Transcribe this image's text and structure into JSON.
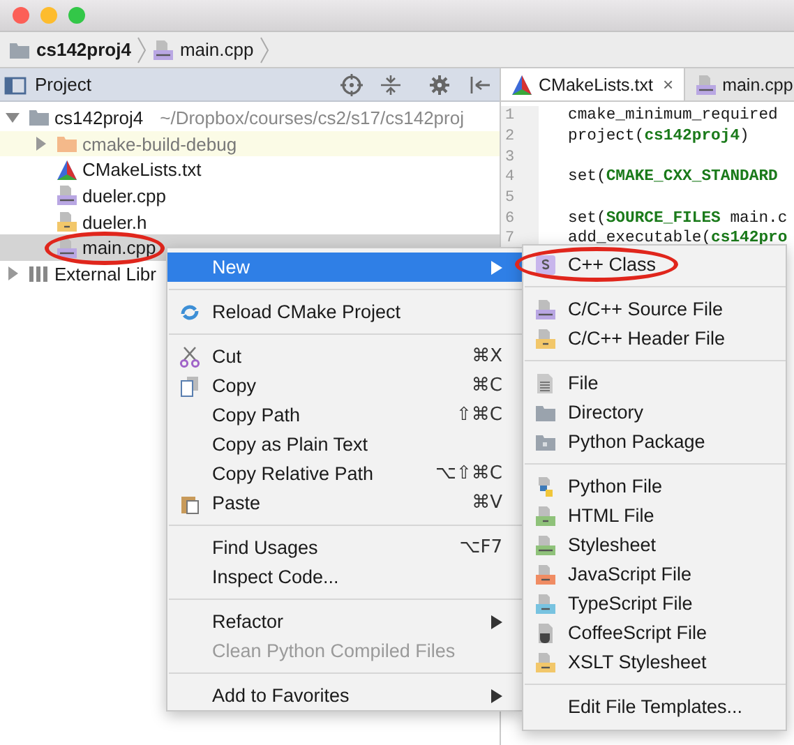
{
  "window": {
    "traffic_lights": [
      {
        "color": "#fc5f57"
      },
      {
        "color": "#fdbc2e"
      },
      {
        "color": "#33c748"
      }
    ]
  },
  "breadcrumbs": [
    {
      "label": "cs142proj4",
      "kind": "folder"
    },
    {
      "label": "main.cpp",
      "kind": "cpp"
    }
  ],
  "project_panel": {
    "title": "Project"
  },
  "tree": [
    {
      "label": "cs142proj4",
      "path": "~/Dropbox/courses/cs2/s17/cs142proj",
      "kind": "module",
      "expanded": true,
      "selected": false,
      "circled": false,
      "children": [
        {
          "label": "cmake-build-debug",
          "kind": "excluded-folder",
          "expanded": false,
          "selected": false,
          "circled": false
        },
        {
          "label": "CMakeLists.txt",
          "kind": "cmake",
          "selected": false,
          "circled": false
        },
        {
          "label": "dueler.cpp",
          "kind": "cpp",
          "selected": false,
          "circled": false
        },
        {
          "label": "dueler.h",
          "kind": "header",
          "selected": false,
          "circled": false
        },
        {
          "label": "main.cpp",
          "kind": "cpp",
          "selected": true,
          "circled": true
        }
      ]
    },
    {
      "label": "External Libr",
      "kind": "libraries",
      "expanded": false,
      "selected": false,
      "circled": false
    }
  ],
  "editor_tabs": [
    {
      "label": "CMakeLists.txt",
      "kind": "cmake",
      "selected": true,
      "close": "×"
    },
    {
      "label": "main.cpp",
      "kind": "cpp",
      "selected": false
    }
  ],
  "code_lines": [
    {
      "number": "1",
      "tokens": [
        {
          "text": "cmake_minimum_required",
          "kind": "plain"
        }
      ]
    },
    {
      "number": "2",
      "tokens": [
        {
          "text": "project(",
          "kind": "plain"
        },
        {
          "text": "cs142proj4",
          "kind": "arg"
        },
        {
          "text": ")",
          "kind": "plain"
        }
      ]
    },
    {
      "number": "3"
    },
    {
      "number": "4",
      "tokens": [
        {
          "text": "set(",
          "kind": "plain"
        },
        {
          "text": "CMAKE_CXX_STANDARD",
          "kind": "arg"
        }
      ]
    },
    {
      "number": "5"
    },
    {
      "number": "6",
      "tokens": [
        {
          "text": "set(",
          "kind": "plain"
        },
        {
          "text": "SOURCE_FILES",
          "kind": "arg"
        },
        {
          "text": " main.c",
          "kind": "plain"
        }
      ]
    },
    {
      "number": "7",
      "tokens": [
        {
          "text": "add_executable(",
          "kind": "plain"
        },
        {
          "text": "cs142pro",
          "kind": "arg"
        }
      ]
    }
  ],
  "context_menu": {
    "groups": [
      [
        {
          "label": "New",
          "submenu": true,
          "disabled": false,
          "selected": true
        }
      ],
      [
        {
          "label": "Reload CMake Project",
          "kind": "reload",
          "submenu": false,
          "disabled": false,
          "selected": false
        }
      ],
      [
        {
          "label": "Cut",
          "kind": "cut",
          "shortcut": "⌘X",
          "submenu": false,
          "disabled": false,
          "selected": false
        },
        {
          "label": "Copy",
          "kind": "copy",
          "shortcut": "⌘C",
          "submenu": false,
          "disabled": false,
          "selected": false
        },
        {
          "label": "Copy Path",
          "shortcut": "⇧⌘C",
          "submenu": false,
          "disabled": false,
          "selected": false
        },
        {
          "label": "Copy as Plain Text",
          "submenu": false,
          "disabled": false,
          "selected": false
        },
        {
          "label": "Copy Relative Path",
          "shortcut": "⌥⇧⌘C",
          "submenu": false,
          "disabled": false,
          "selected": false
        },
        {
          "label": "Paste",
          "kind": "paste",
          "shortcut": "⌘V",
          "submenu": false,
          "disabled": false,
          "selected": false
        }
      ],
      [
        {
          "label": "Find Usages",
          "shortcut": "⌥F7",
          "submenu": false,
          "disabled": false,
          "selected": false
        },
        {
          "label": "Inspect Code...",
          "submenu": false,
          "disabled": false,
          "selected": false
        }
      ],
      [
        {
          "label": "Refactor",
          "submenu": true,
          "disabled": false,
          "selected": false
        },
        {
          "label": "Clean Python Compiled Files",
          "submenu": false,
          "disabled": true,
          "selected": false
        }
      ],
      [
        {
          "label": "Add to Favorites",
          "submenu": true,
          "disabled": false,
          "selected": false
        }
      ]
    ]
  },
  "submenu": {
    "groups": [
      [
        {
          "label": "C++ Class",
          "kind": "class",
          "circled": true
        }
      ],
      [
        {
          "label": "C/C++ Source File",
          "kind": "cpp",
          "circled": false
        },
        {
          "label": "C/C++ Header File",
          "kind": "header",
          "circled": false
        }
      ],
      [
        {
          "label": "File",
          "kind": "text",
          "circled": false
        },
        {
          "label": "Directory",
          "kind": "folder",
          "circled": false
        },
        {
          "label": "Python Package",
          "kind": "package",
          "circled": false
        }
      ],
      [
        {
          "label": "Python File",
          "kind": "python",
          "circled": false
        },
        {
          "label": "HTML File",
          "kind": "html",
          "circled": false
        },
        {
          "label": "Stylesheet",
          "kind": "css",
          "circled": false
        },
        {
          "label": "JavaScript File",
          "kind": "js",
          "circled": false
        },
        {
          "label": "TypeScript File",
          "kind": "ts",
          "circled": false
        },
        {
          "label": "CoffeeScript File",
          "kind": "coffee",
          "circled": false
        },
        {
          "label": "XSLT Stylesheet",
          "kind": "xslt",
          "circled": false
        }
      ],
      [
        {
          "label": "Edit File Templates...",
          "circled": false
        }
      ]
    ]
  }
}
